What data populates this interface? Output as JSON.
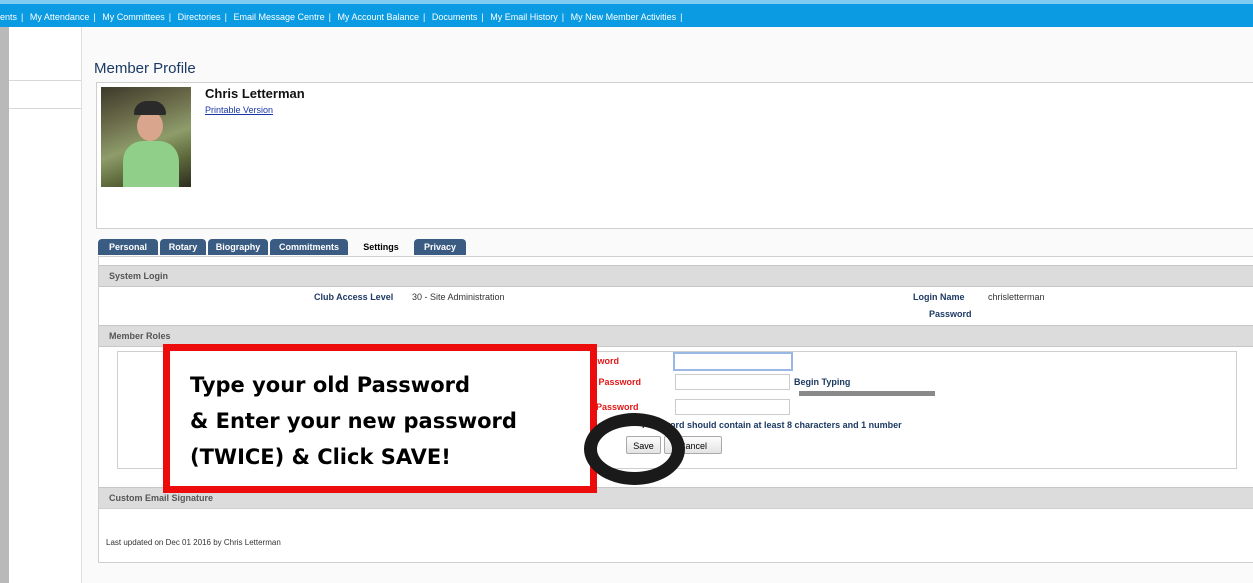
{
  "nav": {
    "links": [
      "ents",
      "My Attendance",
      "My Committees",
      "Directories",
      "Email Message Centre",
      "My Account Balance",
      "Documents",
      "My Email History",
      "My New Member Activities"
    ]
  },
  "profile": {
    "page_title": "Member Profile",
    "member_name": "Chris Letterman",
    "printable_label": "Printable Version"
  },
  "tabs": [
    "Personal",
    "Rotary",
    "Biography",
    "Commitments",
    "Settings",
    "Privacy"
  ],
  "active_tab": "Settings",
  "system_login": {
    "header": "System Login",
    "access_label": "Club Access Level",
    "access_value": "30 - Site Administration",
    "login_name_label": "Login Name",
    "login_name_value": "chrisletterman",
    "password_label": "Password"
  },
  "member_roles": {
    "header": "Member Roles",
    "old_password_label": "Old Password",
    "new_password_label": "Enter New Password",
    "confirm_password_label": "Confirm New Password",
    "begin_typing": "Begin Typing",
    "hint": "Password should contain at least 8 characters and 1 number",
    "save_label": "Save",
    "cancel_label": "Cancel"
  },
  "custom_email": {
    "header": "Custom Email Signature"
  },
  "footer": {
    "updated": "Last updated on Dec 01 2016 by Chris Letterman"
  },
  "callout": {
    "line1": "Type your old Password",
    "line2": "& Enter your new password",
    "line3": "(TWICE) & Click SAVE!"
  },
  "colors": {
    "nav_blue": "#0a9be3",
    "callout_red": "#ec0c0c",
    "label_red": "#e01818",
    "label_navy": "#1c3a63"
  }
}
